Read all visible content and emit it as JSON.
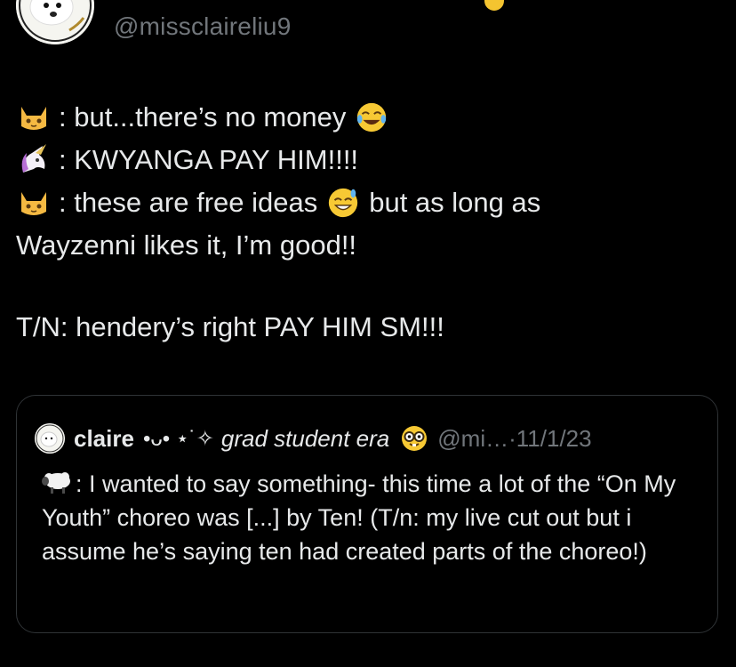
{
  "author": {
    "handle": "@missclaireliu9"
  },
  "tweet": {
    "lines": [
      {
        "speaker_icon": "cat-face-icon",
        "text": ": but...there’s no money",
        "trailing_icon": "tears-of-joy-icon"
      },
      {
        "speaker_icon": "unicorn-icon",
        "text": ": KWYANGA PAY HIM!!!!"
      },
      {
        "speaker_icon": "cat-face-icon",
        "text": ": these are free ideas",
        "inline_icon": "sweat-smile-icon",
        "text_after": "but as long as"
      },
      {
        "text": "Wayzenni likes it, I’m good!!"
      }
    ],
    "tn": "T/N: hendery’s right PAY HIM SM!!!"
  },
  "quote": {
    "name": "claire",
    "name_deco": "•ᴗ• ⋆˙✧",
    "bio_tag": "grad student era",
    "bio_icon": "nerd-face-icon",
    "handle": "@mi…",
    "separator": "·",
    "date": "11/1/23",
    "body_icon": "sheep-icon",
    "body": ": I wanted to say something- this time a lot of the “On My Youth” choreo was [...] by Ten! (T/n: my live cut out but i assume he’s saying ten had created parts of the choreo!)"
  },
  "colors": {
    "background": "#000000",
    "text": "#e7e9ea",
    "secondary": "#71767b",
    "border": "#2f3336"
  }
}
